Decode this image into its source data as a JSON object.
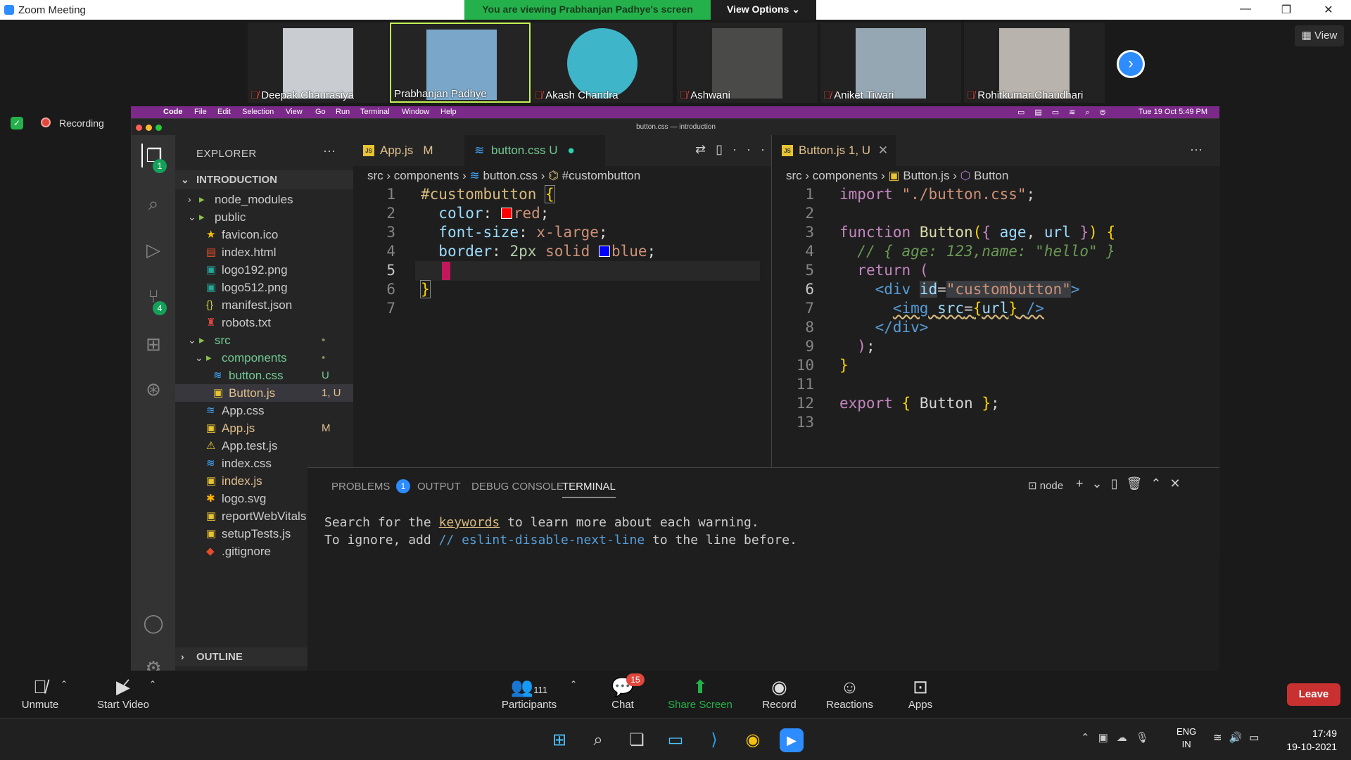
{
  "window_title": "Zoom Meeting",
  "banner": "You are viewing Prabhanjan Padhye's screen",
  "view_options": "View Options ⌄",
  "view_button": "View",
  "recording": "Recording",
  "participants": [
    "Deepak Chaurasiya",
    "Prabhanjan Padhye",
    "Akash Chandra",
    "Ashwani",
    "Aniket Tiwari",
    "Rohitkumar Chaudhari"
  ],
  "mac_menu": [
    "Code",
    "File",
    "Edit",
    "Selection",
    "View",
    "Go",
    "Run",
    "Terminal",
    "Window",
    "Help"
  ],
  "mac_clock": "Tue 19 Oct 5:49 PM",
  "vscode_title": "button.css — introduction",
  "explorer": {
    "header": "EXPLORER",
    "project": "INTRODUCTION",
    "outline": "OUTLINE"
  },
  "files": [
    {
      "name": "node_modules",
      "icon": "folder",
      "status": ""
    },
    {
      "name": "public",
      "icon": "folder",
      "status": ""
    },
    {
      "name": "favicon.ico",
      "icon": "star",
      "status": ""
    },
    {
      "name": "index.html",
      "icon": "html",
      "status": ""
    },
    {
      "name": "logo192.png",
      "icon": "image",
      "status": ""
    },
    {
      "name": "logo512.png",
      "icon": "image",
      "status": ""
    },
    {
      "name": "manifest.json",
      "icon": "json",
      "status": ""
    },
    {
      "name": "robots.txt",
      "icon": "robot",
      "status": ""
    },
    {
      "name": "src",
      "icon": "folder",
      "status": "•"
    },
    {
      "name": "components",
      "icon": "folder",
      "status": "•"
    },
    {
      "name": "button.css",
      "icon": "css",
      "status": "U"
    },
    {
      "name": "Button.js",
      "icon": "js",
      "status": "1, U"
    },
    {
      "name": "App.css",
      "icon": "css",
      "status": ""
    },
    {
      "name": "App.js",
      "icon": "js",
      "status": "M"
    },
    {
      "name": "App.test.js",
      "icon": "test",
      "status": ""
    },
    {
      "name": "index.css",
      "icon": "css",
      "status": ""
    },
    {
      "name": "index.js",
      "icon": "js",
      "status": "M"
    },
    {
      "name": "logo.svg",
      "icon": "svg",
      "status": ""
    },
    {
      "name": "reportWebVitals.js",
      "icon": "js",
      "status": ""
    },
    {
      "name": "setupTests.js",
      "icon": "js",
      "status": ""
    },
    {
      "name": ".gitignore",
      "icon": "git",
      "status": ""
    }
  ],
  "editor1": {
    "tabs": [
      {
        "label": "App.js",
        "status": "M"
      },
      {
        "label": "button.css",
        "status": "U"
      }
    ],
    "breadcrumb": [
      "src",
      "components",
      "button.css",
      "#custombutton"
    ],
    "line_numbers": [
      "1",
      "2",
      "3",
      "4",
      "5",
      "6",
      "7"
    ]
  },
  "editor2": {
    "tab": {
      "label": "Button.js",
      "status": "1, U"
    },
    "breadcrumb": [
      "src",
      "components",
      "Button.js",
      "Button"
    ],
    "line_numbers": [
      "1",
      "2",
      "3",
      "4",
      "5",
      "6",
      "7",
      "8",
      "9",
      "10",
      "11",
      "12",
      "13"
    ]
  },
  "panel": {
    "tabs": [
      "PROBLEMS",
      "OUTPUT",
      "DEBUG CONSOLE",
      "TERMINAL"
    ],
    "problems_count": "1",
    "shell": "node",
    "lines": [
      [
        "Search for the ",
        "keywords",
        " to learn more about each warning."
      ],
      [
        "To ignore, add ",
        "// eslint-disable-next-line",
        " to the line before."
      ]
    ]
  },
  "toolbar": {
    "unmute": "Unmute",
    "start_video": "Start Video",
    "participants": "Participants",
    "participants_count": "111",
    "chat": "Chat",
    "chat_count": "15",
    "share": "Share Screen",
    "record": "Record",
    "reactions": "Reactions",
    "apps": "Apps",
    "leave": "Leave"
  },
  "taskbar": {
    "lang1": "ENG",
    "lang2": "IN",
    "time": "17:49",
    "date": "19-10-2021"
  }
}
